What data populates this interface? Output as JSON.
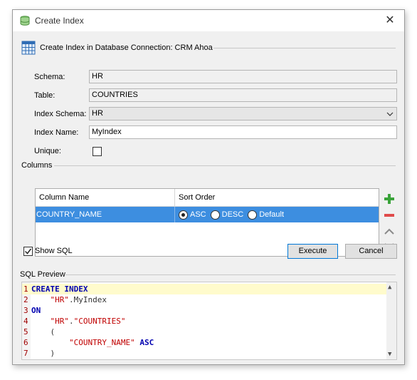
{
  "window": {
    "title": "Create Index",
    "close_glyph": "✕",
    "icon": "database-icon"
  },
  "heading": {
    "text": "Create Index in Database Connection: CRM Ahoa",
    "icon": "table-grid-icon"
  },
  "form": {
    "schema_label": "Schema:",
    "schema_value": "HR",
    "table_label": "Table:",
    "table_value": "COUNTRIES",
    "index_schema_label": "Index Schema:",
    "index_schema_value": "HR",
    "index_name_label": "Index Name:",
    "index_name_value": "MyIndex",
    "unique_label": "Unique:",
    "unique_checked": false
  },
  "columns": {
    "section_label": "Columns",
    "headers": [
      "Column Name",
      "Sort Order"
    ],
    "rows": [
      {
        "column": "COUNTRY_NAME",
        "sort_options": [
          "ASC",
          "DESC",
          "Default"
        ],
        "selected": "ASC"
      }
    ],
    "side_buttons": [
      "add-icon",
      "remove-icon",
      "move-up-icon",
      "move-down-icon"
    ],
    "colors": {
      "add": "#3aa33a",
      "remove": "#e04b4b",
      "selection": "#3d8ee0"
    }
  },
  "show_sql": {
    "label": "Show SQL",
    "checked": true
  },
  "buttons": {
    "execute": "Execute",
    "cancel": "Cancel"
  },
  "sql_preview": {
    "label": "SQL Preview",
    "lines": [
      {
        "n": "1",
        "parts": [
          {
            "t": "CREATE INDEX",
            "c": "kw"
          }
        ]
      },
      {
        "n": "2",
        "parts": [
          {
            "t": "    ",
            "c": "plain"
          },
          {
            "t": "\"HR\"",
            "c": "str"
          },
          {
            "t": ".MyIndex",
            "c": "plain"
          }
        ]
      },
      {
        "n": "3",
        "parts": [
          {
            "t": "ON",
            "c": "kw"
          }
        ]
      },
      {
        "n": "4",
        "parts": [
          {
            "t": "    ",
            "c": "plain"
          },
          {
            "t": "\"HR\"",
            "c": "str"
          },
          {
            "t": ".",
            "c": "plain"
          },
          {
            "t": "\"COUNTRIES\"",
            "c": "str"
          }
        ]
      },
      {
        "n": "5",
        "parts": [
          {
            "t": "    (",
            "c": "plain"
          }
        ]
      },
      {
        "n": "6",
        "parts": [
          {
            "t": "        ",
            "c": "plain"
          },
          {
            "t": "\"COUNTRY_NAME\"",
            "c": "str"
          },
          {
            "t": " ",
            "c": "plain"
          },
          {
            "t": "ASC",
            "c": "kw"
          }
        ]
      },
      {
        "n": "7",
        "parts": [
          {
            "t": "    )",
            "c": "plain"
          }
        ]
      }
    ]
  }
}
